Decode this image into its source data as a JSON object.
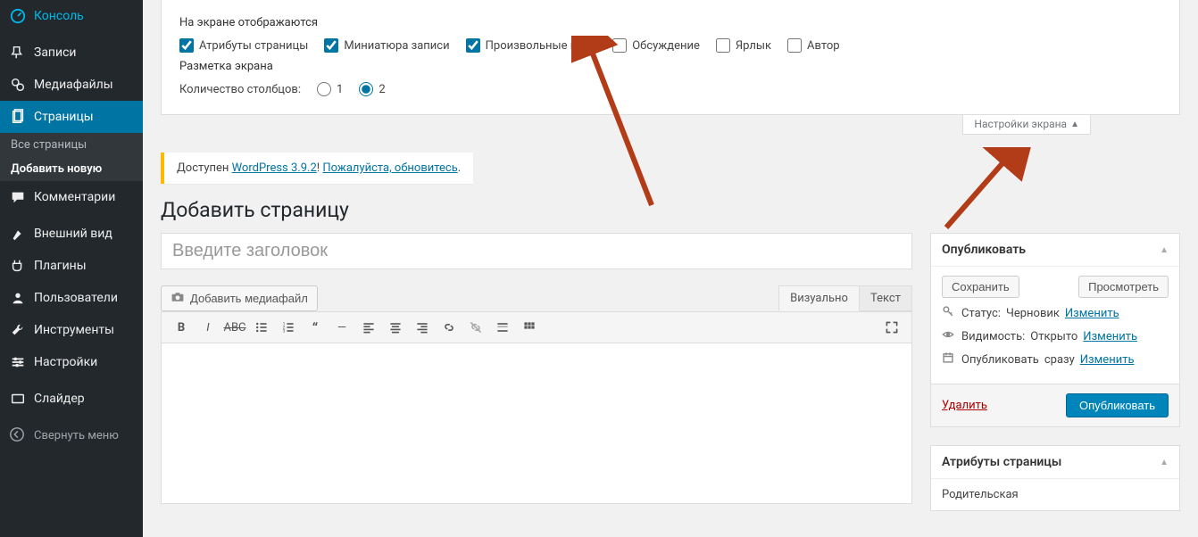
{
  "sidebar": {
    "items": [
      {
        "label": "Консоль",
        "icon": "dashboard"
      },
      {
        "label": "Записи",
        "icon": "pin"
      },
      {
        "label": "Медиафайлы",
        "icon": "media"
      },
      {
        "label": "Страницы",
        "icon": "pages",
        "current": true
      },
      {
        "label": "Комментарии",
        "icon": "comments"
      },
      {
        "label": "Внешний вид",
        "icon": "appearance"
      },
      {
        "label": "Плагины",
        "icon": "plugins"
      },
      {
        "label": "Пользователи",
        "icon": "users"
      },
      {
        "label": "Инструменты",
        "icon": "tools"
      },
      {
        "label": "Настройки",
        "icon": "settings"
      },
      {
        "label": "Слайдер",
        "icon": "slider"
      }
    ],
    "submenu": [
      {
        "label": "Все страницы"
      },
      {
        "label": "Добавить новую",
        "current": true
      }
    ],
    "collapse": "Свернуть меню"
  },
  "screen_options": {
    "display_heading": "На экране отображаются",
    "checkboxes": [
      {
        "label": "Атрибуты страницы",
        "checked": true
      },
      {
        "label": "Миниатюра записи",
        "checked": true
      },
      {
        "label": "Произвольные поля",
        "checked": true
      },
      {
        "label": "Обсуждение",
        "checked": false
      },
      {
        "label": "Ярлык",
        "checked": false
      },
      {
        "label": "Автор",
        "checked": false
      }
    ],
    "layout_heading": "Разметка экрана",
    "columns_label": "Количество столбцов:",
    "columns_options": [
      "1",
      "2"
    ],
    "columns_value": "2",
    "tab_label": "Настройки экрана"
  },
  "notice": {
    "prefix": "Доступен ",
    "link1": "WordPress 3.9.2",
    "mid": "! ",
    "link2": "Пожалуйста, обновитесь",
    "suffix": "."
  },
  "page_heading": "Добавить страницу",
  "title_placeholder": "Введите заголовок",
  "add_media_label": "Добавить медиафайл",
  "editor_tabs": {
    "visual": "Визуально",
    "text": "Текст"
  },
  "publish_box": {
    "title": "Опубликовать",
    "save_draft": "Сохранить",
    "preview": "Просмотреть",
    "status_label": "Статус:",
    "status_value": "Черновик",
    "visibility_label": "Видимость:",
    "visibility_value": "Открыто",
    "schedule_label": "Опубликовать",
    "schedule_value": "сразу",
    "edit": "Изменить",
    "delete": "Удалить",
    "publish": "Опубликовать"
  },
  "attributes_box": {
    "title": "Атрибуты страницы",
    "parent_label": "Родительская"
  }
}
